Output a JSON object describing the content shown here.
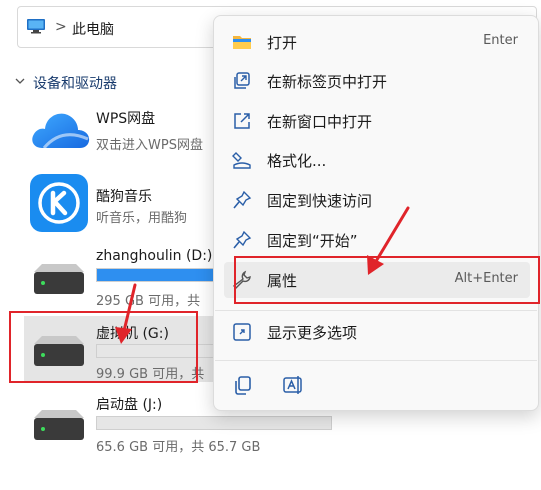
{
  "address_bar": {
    "separator": ">",
    "location": "此电脑",
    "icon": "this-pc-icon"
  },
  "section": {
    "title": "设备和驱动器",
    "icon": "chevron-down-icon"
  },
  "items": {
    "wps": {
      "name": "WPS网盘",
      "sub": "双击进入WPS网盘",
      "icon": "wps-cloud-icon"
    },
    "kugou": {
      "name": "酷狗音乐",
      "sub": "听音乐，用酷狗",
      "icon": "kugou-music-icon"
    },
    "drive_d": {
      "name": "zhanghoulin (D:)",
      "sub": "295 GB 可用，共",
      "used_fraction": 0.5,
      "icon": "hard-drive-icon"
    },
    "drive_g": {
      "name": "虚拟机 (G:)",
      "sub": "99.9 GB 可用，共",
      "used_fraction": 0.0,
      "icon": "hard-drive-icon"
    },
    "drive_j": {
      "name": "启动盘 (J:)",
      "sub": "65.6 GB 可用，共 65.7 GB",
      "used_fraction": 0.0,
      "icon": "hard-drive-icon"
    }
  },
  "context_menu": {
    "items": [
      {
        "label": "打开",
        "shortcut": "Enter",
        "icon": "folder-icon"
      },
      {
        "label": "在新标签页中打开",
        "shortcut": "",
        "icon": "new-tab-icon"
      },
      {
        "label": "在新窗口中打开",
        "shortcut": "",
        "icon": "new-window-icon"
      },
      {
        "label": "格式化...",
        "shortcut": "",
        "icon": "format-drive-icon"
      },
      {
        "label": "固定到快速访问",
        "shortcut": "",
        "icon": "pin-icon"
      },
      {
        "label": "固定到“开始”",
        "shortcut": "",
        "icon": "pin-icon"
      },
      {
        "label": "属性",
        "shortcut": "Alt+Enter",
        "icon": "wrench-icon"
      },
      {
        "label": "显示更多选项",
        "shortcut": "",
        "icon": "more-options-icon"
      }
    ],
    "bottom_actions": [
      {
        "name": "copy",
        "icon": "copy-icon"
      },
      {
        "name": "rename",
        "icon": "rename-icon"
      }
    ]
  },
  "colors": {
    "accent": "#2e8ff0",
    "annotation": "#e0242a",
    "menu_bg": "#f9f9f9",
    "selection": "#e5e5e5"
  }
}
